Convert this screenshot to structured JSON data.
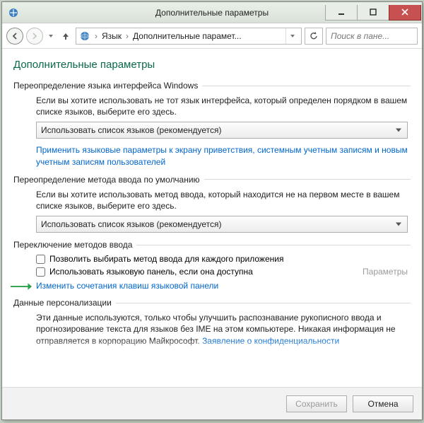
{
  "window": {
    "title": "Дополнительные параметры"
  },
  "nav": {
    "breadcrumb_root": "Язык",
    "breadcrumb_current": "Дополнительные парамет...",
    "search_placeholder": "Поиск в пане..."
  },
  "page": {
    "title": "Дополнительные параметры"
  },
  "section_interface": {
    "legend": "Переопределение языка интерфейса Windows",
    "desc": "Если вы хотите использовать не тот язык интерфейса, который определен порядком в вашем списке языков, выберите его здесь.",
    "combo_value": "Использовать список языков (рекомендуется)",
    "link": "Применить языковые параметры к экрану приветствия, системным учетным записям и новым учетным записям пользователей"
  },
  "section_input": {
    "legend": "Переопределение метода ввода по умолчанию",
    "desc": "Если вы хотите использовать метод ввода, который находится не на первом месте в вашем списке языков, выберите его здесь.",
    "combo_value": "Использовать список языков (рекомендуется)"
  },
  "section_switch": {
    "legend": "Переключение методов ввода",
    "check1_label": "Позволить выбирать метод ввода для каждого приложения",
    "check2_label": "Использовать языковую панель, если она доступна",
    "params_label": "Параметры",
    "hotkeys_link": "Изменить сочетания клавиш языковой панели"
  },
  "section_personal": {
    "legend": "Данные персонализации",
    "desc": "Эти данные используются, только чтобы улучшить распознавание рукописного ввода и прогнозирование текста для языков без IME на этом компьютере. Никакая информация не отправляется в корпорацию Майкрософт.",
    "privacy_link_partial": "Заявление о конфиденциальности"
  },
  "footer": {
    "save": "Сохранить",
    "cancel": "Отмена"
  }
}
